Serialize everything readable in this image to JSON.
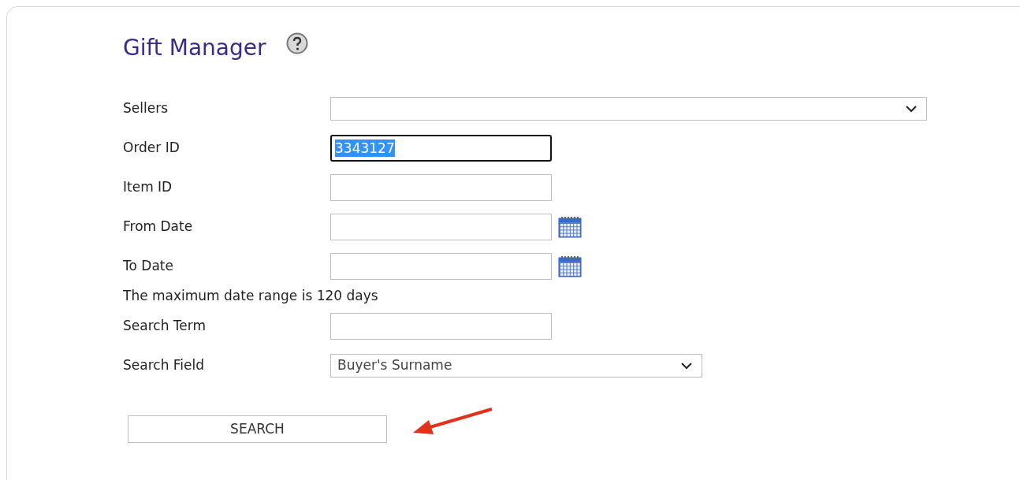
{
  "page": {
    "title": "Gift Manager"
  },
  "fields": [
    {
      "kind": "select",
      "label": "Sellers",
      "wide": true
    },
    {
      "kind": "text",
      "label": "Order ID",
      "value": "3343127",
      "focused": true
    },
    {
      "kind": "text",
      "label": "Item ID",
      "focused": false
    },
    {
      "kind": "date",
      "label": "From Date",
      "focused": false
    },
    {
      "kind": "date",
      "label": "To Date",
      "focused": false
    },
    {
      "kind": "note",
      "label": "The maximum date range is 120 days"
    },
    {
      "kind": "text",
      "label": "Search Term",
      "focused": false
    },
    {
      "kind": "select",
      "label": "Search Field",
      "value": "Buyer's Surname",
      "wide": false
    }
  ],
  "search_button": {
    "label": "SEARCH"
  }
}
